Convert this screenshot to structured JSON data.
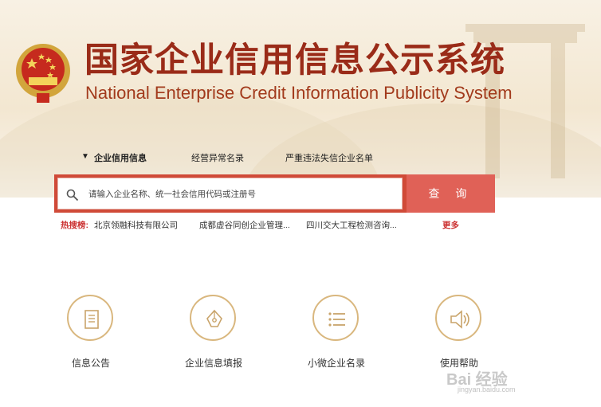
{
  "header": {
    "title_cn": "国家企业信用信息公示系统",
    "title_en": "National Enterprise Credit Information Publicity System"
  },
  "tabs": [
    {
      "label": "企业信用信息",
      "active": true
    },
    {
      "label": "经营异常名录",
      "active": false
    },
    {
      "label": "严重违法失信企业名单",
      "active": false
    }
  ],
  "search": {
    "placeholder": "请输入企业名称、统一社会信用代码或注册号",
    "button_label": "查  询"
  },
  "hot_search": {
    "label": "热搜榜:",
    "items": [
      "北京领融科技有限公司",
      "成都虚谷同创企业管理...",
      "四川交大工程检测咨询..."
    ],
    "more_label": "更多"
  },
  "services": [
    {
      "label": "信息公告",
      "icon": "document-icon"
    },
    {
      "label": "企业信息填报",
      "icon": "pen-icon"
    },
    {
      "label": "小微企业名录",
      "icon": "list-icon"
    },
    {
      "label": "使用帮助",
      "icon": "speaker-icon"
    }
  ],
  "watermark": {
    "text": "Bai 经验",
    "url": "jingyan.baidu.com"
  },
  "colors": {
    "brand_red": "#9a2b18",
    "search_red": "#d04a38",
    "gold": "#d9b77e"
  }
}
